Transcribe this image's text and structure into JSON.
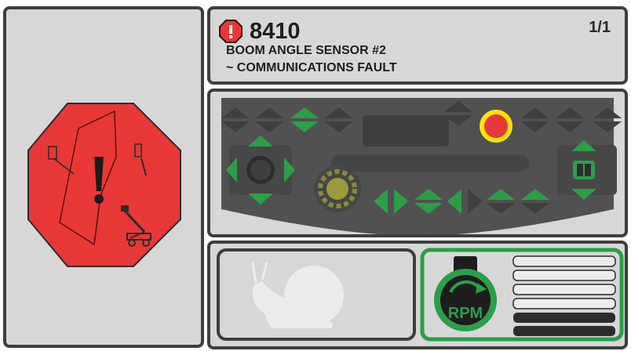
{
  "fault": {
    "code": "8410",
    "page_indicator": "1/1",
    "line1": "BOOM ANGLE SENSOR #2",
    "line2": "~ COMMUNICATIONS FAULT"
  },
  "rpm_indicator": {
    "label": "RPM"
  },
  "colors": {
    "alarm_red": "#e83737",
    "active_green": "#2a9f48",
    "inactive_dark": "#3f3f3f",
    "indicator_yellow": "#ffe400"
  }
}
